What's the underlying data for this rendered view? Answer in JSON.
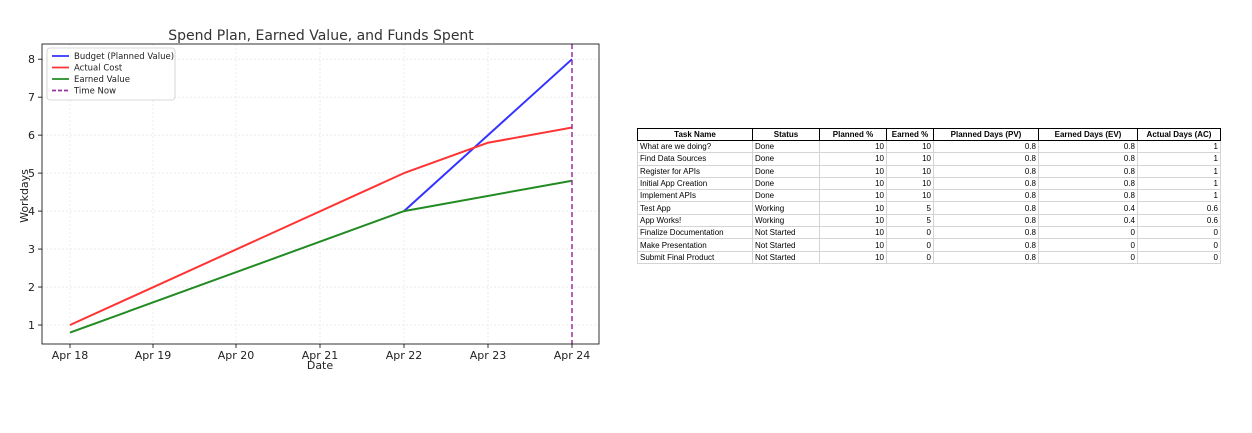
{
  "chart_data": {
    "type": "line",
    "title": "Spend Plan, Earned Value, and Funds Spent",
    "xlabel": "Date",
    "ylabel": "Workdays",
    "categories": [
      "Apr 18",
      "Apr 19",
      "Apr 20",
      "Apr 21",
      "Apr 22",
      "Apr 23",
      "Apr 24"
    ],
    "xlim": [
      "Apr 18",
      "Apr 24"
    ],
    "ylim": [
      0.5,
      8.4
    ],
    "yticks": [
      1,
      2,
      3,
      4,
      5,
      6,
      7,
      8
    ],
    "grid": true,
    "legend_position": "top-left",
    "series": [
      {
        "name": "Budget (Planned Value)",
        "color": "#3333ff",
        "points": [
          {
            "x": "Apr 22",
            "y": 4.0
          },
          {
            "x": "Apr 24",
            "y": 8.0
          }
        ]
      },
      {
        "name": "Actual Cost",
        "color": "#ff3333",
        "points": [
          {
            "x": "Apr 18",
            "y": 1.0
          },
          {
            "x": "Apr 22",
            "y": 5.0
          },
          {
            "x": "Apr 23",
            "y": 5.8
          },
          {
            "x": "Apr 24",
            "y": 6.2
          }
        ]
      },
      {
        "name": "Earned Value",
        "color": "#228b22",
        "points": [
          {
            "x": "Apr 18",
            "y": 0.8
          },
          {
            "x": "Apr 22",
            "y": 4.0
          },
          {
            "x": "Apr 24",
            "y": 4.8
          }
        ]
      }
    ],
    "vline": {
      "name": "Time Now",
      "x": "Apr 24",
      "color": "#9b30a0",
      "style": "dashed"
    }
  },
  "table": {
    "columns": [
      "Task Name",
      "Status",
      "Planned %",
      "Earned %",
      "Planned Days (PV)",
      "Earned Days (EV)",
      "Actual Days (AC)"
    ],
    "rows": [
      [
        "What are we doing?",
        "Done",
        "10",
        "10",
        "0.8",
        "0.8",
        "1"
      ],
      [
        "Find Data Sources",
        "Done",
        "10",
        "10",
        "0.8",
        "0.8",
        "1"
      ],
      [
        "Register for APIs",
        "Done",
        "10",
        "10",
        "0.8",
        "0.8",
        "1"
      ],
      [
        "Initial App Creation",
        "Done",
        "10",
        "10",
        "0.8",
        "0.8",
        "1"
      ],
      [
        "Implement APIs",
        "Done",
        "10",
        "10",
        "0.8",
        "0.8",
        "1"
      ],
      [
        "Test App",
        "Working",
        "10",
        "5",
        "0.8",
        "0.4",
        "0.6"
      ],
      [
        "App Works!",
        "Working",
        "10",
        "5",
        "0.8",
        "0.4",
        "0.6"
      ],
      [
        "Finalize Documentation",
        "Not Started",
        "10",
        "0",
        "0.8",
        "0",
        "0"
      ],
      [
        "Make Presentation",
        "Not Started",
        "10",
        "0",
        "0.8",
        "0",
        "0"
      ],
      [
        "Submit Final Product",
        "Not Started",
        "10",
        "0",
        "0.8",
        "0",
        "0"
      ]
    ]
  }
}
